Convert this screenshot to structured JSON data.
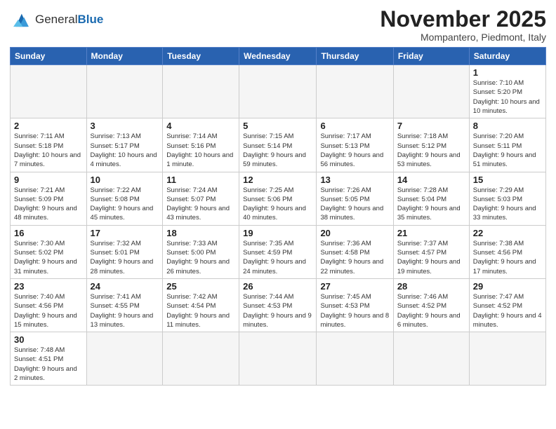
{
  "header": {
    "logo_general": "General",
    "logo_blue": "Blue",
    "month_title": "November 2025",
    "subtitle": "Mompantero, Piedmont, Italy"
  },
  "weekdays": [
    "Sunday",
    "Monday",
    "Tuesday",
    "Wednesday",
    "Thursday",
    "Friday",
    "Saturday"
  ],
  "weeks": [
    [
      {
        "day": "",
        "info": ""
      },
      {
        "day": "",
        "info": ""
      },
      {
        "day": "",
        "info": ""
      },
      {
        "day": "",
        "info": ""
      },
      {
        "day": "",
        "info": ""
      },
      {
        "day": "",
        "info": ""
      },
      {
        "day": "1",
        "info": "Sunrise: 7:10 AM\nSunset: 5:20 PM\nDaylight: 10 hours and 10 minutes."
      }
    ],
    [
      {
        "day": "2",
        "info": "Sunrise: 7:11 AM\nSunset: 5:18 PM\nDaylight: 10 hours and 7 minutes."
      },
      {
        "day": "3",
        "info": "Sunrise: 7:13 AM\nSunset: 5:17 PM\nDaylight: 10 hours and 4 minutes."
      },
      {
        "day": "4",
        "info": "Sunrise: 7:14 AM\nSunset: 5:16 PM\nDaylight: 10 hours and 1 minute."
      },
      {
        "day": "5",
        "info": "Sunrise: 7:15 AM\nSunset: 5:14 PM\nDaylight: 9 hours and 59 minutes."
      },
      {
        "day": "6",
        "info": "Sunrise: 7:17 AM\nSunset: 5:13 PM\nDaylight: 9 hours and 56 minutes."
      },
      {
        "day": "7",
        "info": "Sunrise: 7:18 AM\nSunset: 5:12 PM\nDaylight: 9 hours and 53 minutes."
      },
      {
        "day": "8",
        "info": "Sunrise: 7:20 AM\nSunset: 5:11 PM\nDaylight: 9 hours and 51 minutes."
      }
    ],
    [
      {
        "day": "9",
        "info": "Sunrise: 7:21 AM\nSunset: 5:09 PM\nDaylight: 9 hours and 48 minutes."
      },
      {
        "day": "10",
        "info": "Sunrise: 7:22 AM\nSunset: 5:08 PM\nDaylight: 9 hours and 45 minutes."
      },
      {
        "day": "11",
        "info": "Sunrise: 7:24 AM\nSunset: 5:07 PM\nDaylight: 9 hours and 43 minutes."
      },
      {
        "day": "12",
        "info": "Sunrise: 7:25 AM\nSunset: 5:06 PM\nDaylight: 9 hours and 40 minutes."
      },
      {
        "day": "13",
        "info": "Sunrise: 7:26 AM\nSunset: 5:05 PM\nDaylight: 9 hours and 38 minutes."
      },
      {
        "day": "14",
        "info": "Sunrise: 7:28 AM\nSunset: 5:04 PM\nDaylight: 9 hours and 35 minutes."
      },
      {
        "day": "15",
        "info": "Sunrise: 7:29 AM\nSunset: 5:03 PM\nDaylight: 9 hours and 33 minutes."
      }
    ],
    [
      {
        "day": "16",
        "info": "Sunrise: 7:30 AM\nSunset: 5:02 PM\nDaylight: 9 hours and 31 minutes."
      },
      {
        "day": "17",
        "info": "Sunrise: 7:32 AM\nSunset: 5:01 PM\nDaylight: 9 hours and 28 minutes."
      },
      {
        "day": "18",
        "info": "Sunrise: 7:33 AM\nSunset: 5:00 PM\nDaylight: 9 hours and 26 minutes."
      },
      {
        "day": "19",
        "info": "Sunrise: 7:35 AM\nSunset: 4:59 PM\nDaylight: 9 hours and 24 minutes."
      },
      {
        "day": "20",
        "info": "Sunrise: 7:36 AM\nSunset: 4:58 PM\nDaylight: 9 hours and 22 minutes."
      },
      {
        "day": "21",
        "info": "Sunrise: 7:37 AM\nSunset: 4:57 PM\nDaylight: 9 hours and 19 minutes."
      },
      {
        "day": "22",
        "info": "Sunrise: 7:38 AM\nSunset: 4:56 PM\nDaylight: 9 hours and 17 minutes."
      }
    ],
    [
      {
        "day": "23",
        "info": "Sunrise: 7:40 AM\nSunset: 4:56 PM\nDaylight: 9 hours and 15 minutes."
      },
      {
        "day": "24",
        "info": "Sunrise: 7:41 AM\nSunset: 4:55 PM\nDaylight: 9 hours and 13 minutes."
      },
      {
        "day": "25",
        "info": "Sunrise: 7:42 AM\nSunset: 4:54 PM\nDaylight: 9 hours and 11 minutes."
      },
      {
        "day": "26",
        "info": "Sunrise: 7:44 AM\nSunset: 4:53 PM\nDaylight: 9 hours and 9 minutes."
      },
      {
        "day": "27",
        "info": "Sunrise: 7:45 AM\nSunset: 4:53 PM\nDaylight: 9 hours and 8 minutes."
      },
      {
        "day": "28",
        "info": "Sunrise: 7:46 AM\nSunset: 4:52 PM\nDaylight: 9 hours and 6 minutes."
      },
      {
        "day": "29",
        "info": "Sunrise: 7:47 AM\nSunset: 4:52 PM\nDaylight: 9 hours and 4 minutes."
      }
    ],
    [
      {
        "day": "30",
        "info": "Sunrise: 7:48 AM\nSunset: 4:51 PM\nDaylight: 9 hours and 2 minutes."
      },
      {
        "day": "",
        "info": ""
      },
      {
        "day": "",
        "info": ""
      },
      {
        "day": "",
        "info": ""
      },
      {
        "day": "",
        "info": ""
      },
      {
        "day": "",
        "info": ""
      },
      {
        "day": "",
        "info": ""
      }
    ]
  ]
}
